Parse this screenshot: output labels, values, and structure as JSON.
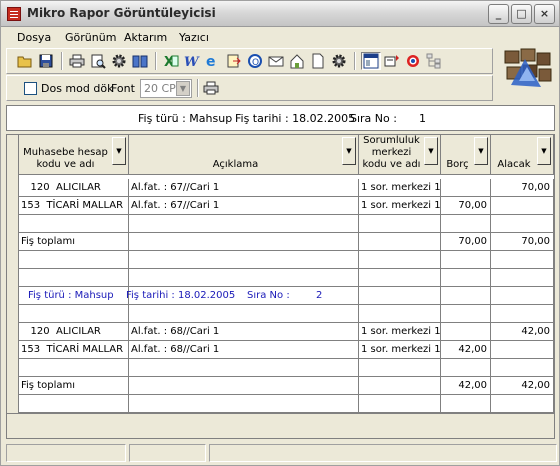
{
  "window": {
    "title": "Mikro Rapor Görüntüleyicisi",
    "min_glyph": "_",
    "max_glyph": "□",
    "close_glyph": "×"
  },
  "menu": [
    {
      "label": "Dosya"
    },
    {
      "label": "Görünüm"
    },
    {
      "label": "Aktarım"
    },
    {
      "label": "Yazıcı"
    }
  ],
  "toolbar": {
    "dos_mode_label": "Dos mod dök",
    "font_label": "Font",
    "font_value": "20 CPI",
    "icons": [
      "open-folder-icon",
      "save-icon",
      "print-icon",
      "print-preview-icon",
      "settings-gear-icon",
      "book-icon",
      "excel-icon",
      "word-icon",
      "internet-explorer-icon",
      "export-icon",
      "outlook-icon",
      "mail-icon",
      "html-icon",
      "document-icon",
      "settings-icon",
      "grid-view-icon",
      "report-icon",
      "color-icon",
      "tree-icon",
      "printer-icon"
    ]
  },
  "header_band": {
    "fis_turu": "Fiş türü : Mahsup",
    "fis_tarihi": "Fiş tarihi : 18.02.2005",
    "sira_no_label": "Sıra No :",
    "sira_no": "1"
  },
  "columns": [
    {
      "label": "Muhasebe hesap kodu ve adı"
    },
    {
      "label": "Açıklama"
    },
    {
      "label": "Sorumluluk merkezi kodu ve adı"
    },
    {
      "label": "Borç"
    },
    {
      "label": "Alacak"
    }
  ],
  "rows": [
    [
      "   120  ALICILAR",
      "Al.fat. : 67//Cari 1",
      "1 sor. merkezi 1",
      "",
      "70,00"
    ],
    [
      "153  TİCARİ MALLAR",
      "Al.fat. : 67//Cari 1",
      "1 sor. merkezi 1",
      "70,00",
      ""
    ],
    [
      "",
      "",
      "",
      "",
      ""
    ],
    [
      "Fiş toplamı",
      "",
      "",
      "70,00",
      "70,00"
    ],
    [
      "",
      "",
      "",
      "",
      ""
    ],
    [
      "",
      "",
      "",
      "",
      ""
    ],
    [
      "",
      "",
      "",
      "",
      ""
    ],
    [
      "",
      "",
      "",
      "",
      ""
    ],
    [
      "   120  ALICILAR",
      "Al.fat. : 68//Cari 1",
      "1 sor. merkezi 1",
      "",
      "42,00"
    ],
    [
      "153  TİCARİ MALLAR",
      "Al.fat. : 68//Cari 1",
      "1 sor. merkezi 1",
      "42,00",
      ""
    ],
    [
      "",
      "",
      "",
      "",
      ""
    ],
    [
      "Fiş toplamı",
      "",
      "",
      "42,00",
      "42,00"
    ],
    [
      "",
      "",
      "",
      "",
      ""
    ]
  ],
  "subheader": {
    "fis_turu": "Fiş türü : Mahsup",
    "fis_tarihi": "Fiş tarihi : 18.02.2005",
    "sira_no_label": "Sıra No :",
    "sira_no": "2"
  }
}
